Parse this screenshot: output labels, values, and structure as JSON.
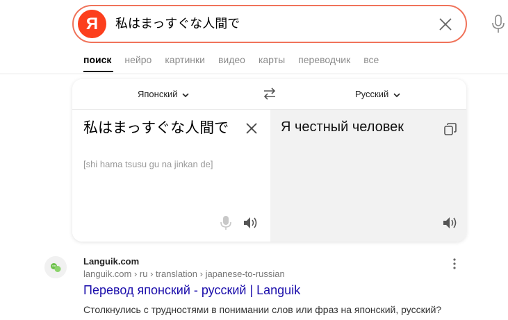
{
  "search": {
    "logo_letter": "Я",
    "query": "私はまっすぐな人間で"
  },
  "tabs": [
    {
      "label": "поиск",
      "active": true
    },
    {
      "label": "нейро"
    },
    {
      "label": "картинки"
    },
    {
      "label": "видео"
    },
    {
      "label": "карты"
    },
    {
      "label": "переводчик"
    },
    {
      "label": "все"
    }
  ],
  "translator": {
    "source_lang": "Японский",
    "target_lang": "Русский",
    "source_text": "私はまっすぐな人間で",
    "transliteration": "[shi hama tsusu gu na jinkan de]",
    "translation": "Я честный человек"
  },
  "result": {
    "site_name": "Languik.com",
    "breadcrumb": "languik.com › ru › translation › japanese-to-russian",
    "title": "Перевод японский - русский | Languik",
    "snippet": "Столкнулись с трудностями в понимании слов или фраз на японский, русский?"
  },
  "colors": {
    "brand": "#fc3f1d",
    "search_border": "#f0735a",
    "link": "#1a0dab",
    "favicon_accent": "#6cc04a"
  }
}
